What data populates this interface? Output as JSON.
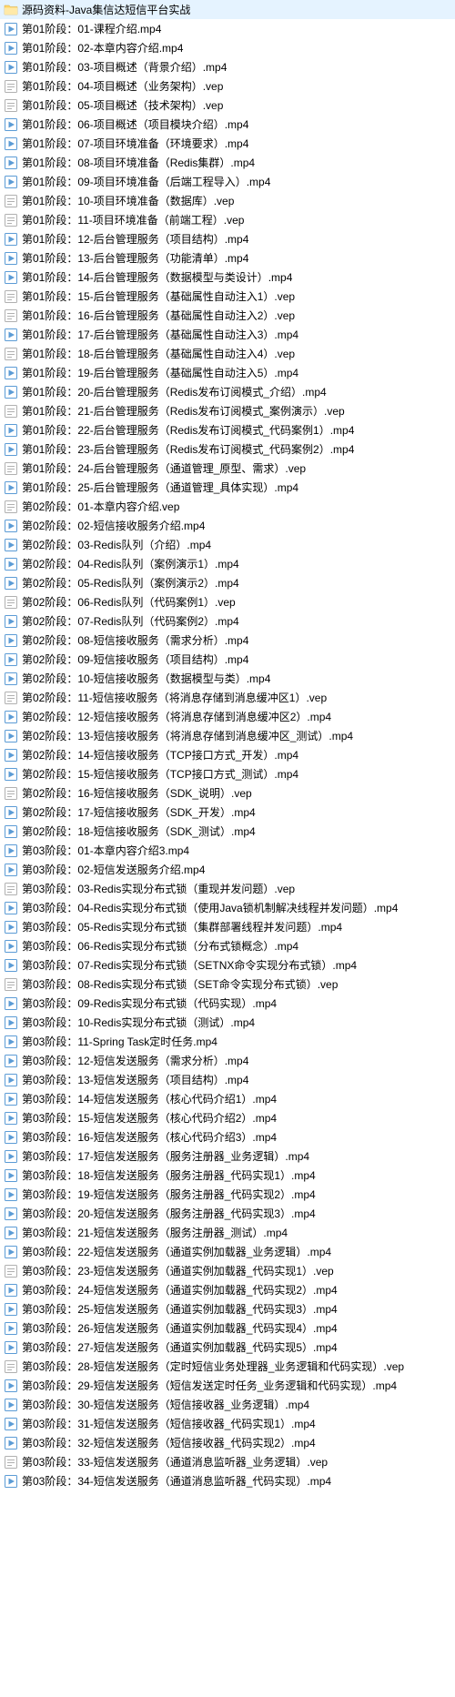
{
  "items": [
    {
      "type": "folder",
      "label": "源码资料-Java集信达短信平台实战"
    },
    {
      "type": "mp4",
      "label": "第01阶段：01-课程介绍.mp4"
    },
    {
      "type": "mp4",
      "label": "第01阶段：02-本章内容介绍.mp4"
    },
    {
      "type": "mp4",
      "label": "第01阶段：03-项目概述（背景介绍）.mp4"
    },
    {
      "type": "vep",
      "label": "第01阶段：04-项目概述（业务架构）.vep"
    },
    {
      "type": "vep",
      "label": "第01阶段：05-项目概述（技术架构）.vep"
    },
    {
      "type": "mp4",
      "label": "第01阶段：06-项目概述（项目模块介绍）.mp4"
    },
    {
      "type": "mp4",
      "label": "第01阶段：07-项目环境准备（环境要求）.mp4"
    },
    {
      "type": "mp4",
      "label": "第01阶段：08-项目环境准备（Redis集群）.mp4"
    },
    {
      "type": "mp4",
      "label": "第01阶段：09-项目环境准备（后端工程导入）.mp4"
    },
    {
      "type": "vep",
      "label": "第01阶段：10-项目环境准备（数据库）.vep"
    },
    {
      "type": "vep",
      "label": "第01阶段：11-项目环境准备（前端工程）.vep"
    },
    {
      "type": "mp4",
      "label": "第01阶段：12-后台管理服务（项目结构）.mp4"
    },
    {
      "type": "mp4",
      "label": "第01阶段：13-后台管理服务（功能清单）.mp4"
    },
    {
      "type": "mp4",
      "label": "第01阶段：14-后台管理服务（数据模型与类设计）.mp4"
    },
    {
      "type": "vep",
      "label": "第01阶段：15-后台管理服务（基础属性自动注入1）.vep"
    },
    {
      "type": "vep",
      "label": "第01阶段：16-后台管理服务（基础属性自动注入2）.vep"
    },
    {
      "type": "mp4",
      "label": "第01阶段：17-后台管理服务（基础属性自动注入3）.mp4"
    },
    {
      "type": "vep",
      "label": "第01阶段：18-后台管理服务（基础属性自动注入4）.vep"
    },
    {
      "type": "mp4",
      "label": "第01阶段：19-后台管理服务（基础属性自动注入5）.mp4"
    },
    {
      "type": "mp4",
      "label": "第01阶段：20-后台管理服务（Redis发布订阅模式_介绍）.mp4"
    },
    {
      "type": "vep",
      "label": "第01阶段：21-后台管理服务（Redis发布订阅模式_案例演示）.vep"
    },
    {
      "type": "mp4",
      "label": "第01阶段：22-后台管理服务（Redis发布订阅模式_代码案例1）.mp4"
    },
    {
      "type": "mp4",
      "label": "第01阶段：23-后台管理服务（Redis发布订阅模式_代码案例2）.mp4"
    },
    {
      "type": "vep",
      "label": "第01阶段：24-后台管理服务（通道管理_原型、需求）.vep"
    },
    {
      "type": "mp4",
      "label": "第01阶段：25-后台管理服务（通道管理_具体实现）.mp4"
    },
    {
      "type": "vep",
      "label": "第02阶段：01-本章内容介绍.vep"
    },
    {
      "type": "mp4",
      "label": "第02阶段：02-短信接收服务介绍.mp4"
    },
    {
      "type": "mp4",
      "label": "第02阶段：03-Redis队列（介绍）.mp4"
    },
    {
      "type": "mp4",
      "label": "第02阶段：04-Redis队列（案例演示1）.mp4"
    },
    {
      "type": "mp4",
      "label": "第02阶段：05-Redis队列（案例演示2）.mp4"
    },
    {
      "type": "vep",
      "label": "第02阶段：06-Redis队列（代码案例1）.vep"
    },
    {
      "type": "mp4",
      "label": "第02阶段：07-Redis队列（代码案例2）.mp4"
    },
    {
      "type": "mp4",
      "label": "第02阶段：08-短信接收服务（需求分析）.mp4"
    },
    {
      "type": "mp4",
      "label": "第02阶段：09-短信接收服务（项目结构）.mp4"
    },
    {
      "type": "mp4",
      "label": "第02阶段：10-短信接收服务（数据模型与类）.mp4"
    },
    {
      "type": "vep",
      "label": "第02阶段：11-短信接收服务（将消息存储到消息缓冲区1）.vep"
    },
    {
      "type": "mp4",
      "label": "第02阶段：12-短信接收服务（将消息存储到消息缓冲区2）.mp4"
    },
    {
      "type": "mp4",
      "label": "第02阶段：13-短信接收服务（将消息存储到消息缓冲区_测试）.mp4"
    },
    {
      "type": "mp4",
      "label": "第02阶段：14-短信接收服务（TCP接口方式_开发）.mp4"
    },
    {
      "type": "mp4",
      "label": "第02阶段：15-短信接收服务（TCP接口方式_测试）.mp4"
    },
    {
      "type": "vep",
      "label": "第02阶段：16-短信接收服务（SDK_说明）.vep"
    },
    {
      "type": "mp4",
      "label": "第02阶段：17-短信接收服务（SDK_开发）.mp4"
    },
    {
      "type": "mp4",
      "label": "第02阶段：18-短信接收服务（SDK_测试）.mp4"
    },
    {
      "type": "mp4",
      "label": "第03阶段：01-本章内容介绍3.mp4"
    },
    {
      "type": "mp4",
      "label": "第03阶段：02-短信发送服务介绍.mp4"
    },
    {
      "type": "vep",
      "label": "第03阶段：03-Redis实现分布式锁（重现并发问题）.vep"
    },
    {
      "type": "mp4",
      "label": "第03阶段：04-Redis实现分布式锁（使用Java锁机制解决线程并发问题）.mp4"
    },
    {
      "type": "mp4",
      "label": "第03阶段：05-Redis实现分布式锁（集群部署线程并发问题）.mp4"
    },
    {
      "type": "mp4",
      "label": "第03阶段：06-Redis实现分布式锁（分布式锁概念）.mp4"
    },
    {
      "type": "mp4",
      "label": "第03阶段：07-Redis实现分布式锁（SETNX命令实现分布式锁）.mp4"
    },
    {
      "type": "vep",
      "label": "第03阶段：08-Redis实现分布式锁（SET命令实现分布式锁）.vep"
    },
    {
      "type": "mp4",
      "label": "第03阶段：09-Redis实现分布式锁（代码实现）.mp4"
    },
    {
      "type": "mp4",
      "label": "第03阶段：10-Redis实现分布式锁（测试）.mp4"
    },
    {
      "type": "mp4",
      "label": "第03阶段：11-Spring Task定时任务.mp4"
    },
    {
      "type": "mp4",
      "label": "第03阶段：12-短信发送服务（需求分析）.mp4"
    },
    {
      "type": "mp4",
      "label": "第03阶段：13-短信发送服务（项目结构）.mp4"
    },
    {
      "type": "mp4",
      "label": "第03阶段：14-短信发送服务（核心代码介绍1）.mp4"
    },
    {
      "type": "mp4",
      "label": "第03阶段：15-短信发送服务（核心代码介绍2）.mp4"
    },
    {
      "type": "mp4",
      "label": "第03阶段：16-短信发送服务（核心代码介绍3）.mp4"
    },
    {
      "type": "mp4",
      "label": "第03阶段：17-短信发送服务（服务注册器_业务逻辑）.mp4"
    },
    {
      "type": "mp4",
      "label": "第03阶段：18-短信发送服务（服务注册器_代码实现1）.mp4"
    },
    {
      "type": "mp4",
      "label": "第03阶段：19-短信发送服务（服务注册器_代码实现2）.mp4"
    },
    {
      "type": "mp4",
      "label": "第03阶段：20-短信发送服务（服务注册器_代码实现3）.mp4"
    },
    {
      "type": "mp4",
      "label": "第03阶段：21-短信发送服务（服务注册器_测试）.mp4"
    },
    {
      "type": "mp4",
      "label": "第03阶段：22-短信发送服务（通道实例加载器_业务逻辑）.mp4"
    },
    {
      "type": "vep",
      "label": "第03阶段：23-短信发送服务（通道实例加载器_代码实现1）.vep"
    },
    {
      "type": "mp4",
      "label": "第03阶段：24-短信发送服务（通道实例加载器_代码实现2）.mp4"
    },
    {
      "type": "mp4",
      "label": "第03阶段：25-短信发送服务（通道实例加载器_代码实现3）.mp4"
    },
    {
      "type": "mp4",
      "label": "第03阶段：26-短信发送服务（通道实例加载器_代码实现4）.mp4"
    },
    {
      "type": "mp4",
      "label": "第03阶段：27-短信发送服务（通道实例加载器_代码实现5）.mp4"
    },
    {
      "type": "vep",
      "label": "第03阶段：28-短信发送服务（定时短信业务处理器_业务逻辑和代码实现）.vep"
    },
    {
      "type": "mp4",
      "label": "第03阶段：29-短信发送服务（短信发送定时任务_业务逻辑和代码实现）.mp4"
    },
    {
      "type": "mp4",
      "label": "第03阶段：30-短信发送服务（短信接收器_业务逻辑）.mp4"
    },
    {
      "type": "mp4",
      "label": "第03阶段：31-短信发送服务（短信接收器_代码实现1）.mp4"
    },
    {
      "type": "mp4",
      "label": "第03阶段：32-短信发送服务（短信接收器_代码实现2）.mp4"
    },
    {
      "type": "vep",
      "label": "第03阶段：33-短信发送服务（通道消息监听器_业务逻辑）.vep"
    },
    {
      "type": "mp4",
      "label": "第03阶段：34-短信发送服务（通道消息监听器_代码实现）.mp4"
    }
  ]
}
